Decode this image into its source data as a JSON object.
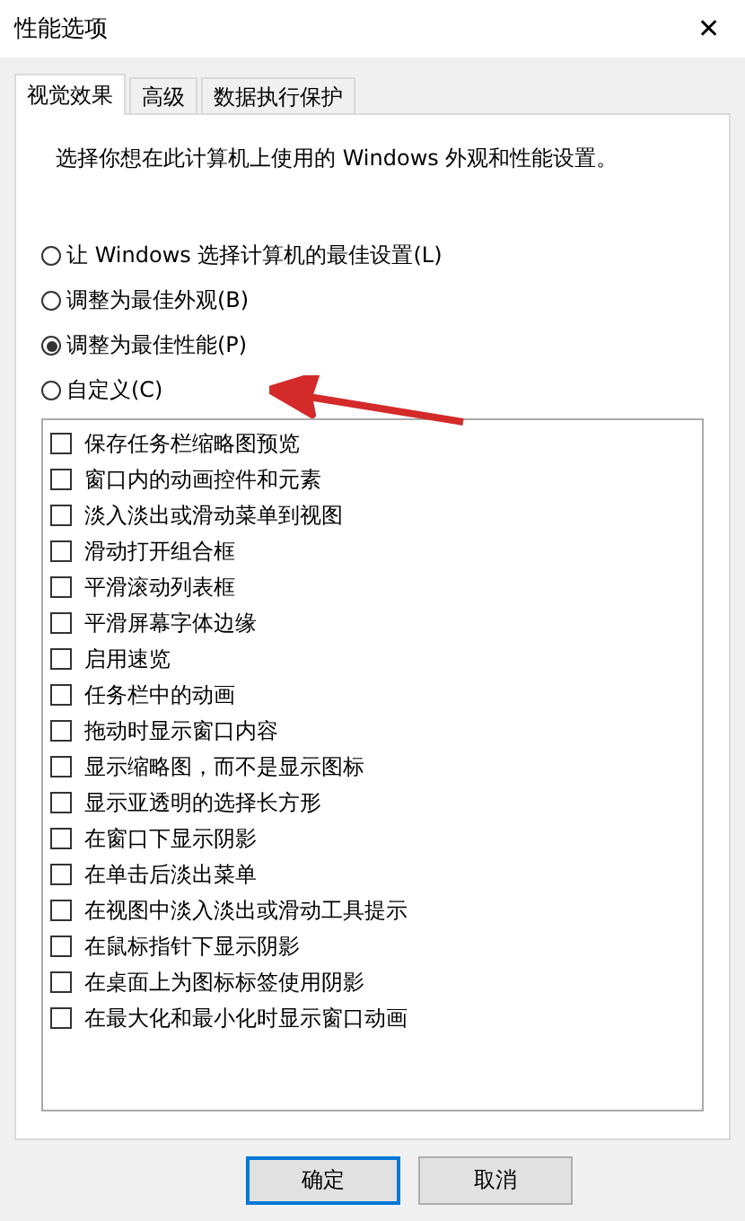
{
  "window": {
    "title": "性能选项",
    "close": "✕"
  },
  "tabs": [
    {
      "label": "视觉效果",
      "selected": true
    },
    {
      "label": "高级",
      "selected": false
    },
    {
      "label": "数据执行保护",
      "selected": false
    }
  ],
  "description": "选择你想在此计算机上使用的 Windows 外观和性能设置。",
  "options": [
    {
      "label": "让 Windows 选择计算机的最佳设置(L)",
      "selected": false
    },
    {
      "label": "调整为最佳外观(B)",
      "selected": false
    },
    {
      "label": "调整为最佳性能(P)",
      "selected": true
    },
    {
      "label": "自定义(C)",
      "selected": false
    }
  ],
  "effects": [
    {
      "label": "保存任务栏缩略图预览",
      "checked": false
    },
    {
      "label": "窗口内的动画控件和元素",
      "checked": false
    },
    {
      "label": "淡入淡出或滑动菜单到视图",
      "checked": false
    },
    {
      "label": "滑动打开组合框",
      "checked": false
    },
    {
      "label": "平滑滚动列表框",
      "checked": false
    },
    {
      "label": "平滑屏幕字体边缘",
      "checked": false
    },
    {
      "label": "启用速览",
      "checked": false
    },
    {
      "label": "任务栏中的动画",
      "checked": false
    },
    {
      "label": "拖动时显示窗口内容",
      "checked": false
    },
    {
      "label": "显示缩略图，而不是显示图标",
      "checked": false
    },
    {
      "label": "显示亚透明的选择长方形",
      "checked": false
    },
    {
      "label": "在窗口下显示阴影",
      "checked": false
    },
    {
      "label": "在单击后淡出菜单",
      "checked": false
    },
    {
      "label": "在视图中淡入淡出或滑动工具提示",
      "checked": false
    },
    {
      "label": "在鼠标指针下显示阴影",
      "checked": false
    },
    {
      "label": "在桌面上为图标标签使用阴影",
      "checked": false
    },
    {
      "label": "在最大化和最小化时显示窗口动画",
      "checked": false
    }
  ],
  "buttons": [
    {
      "label": "确定",
      "kind": "default"
    },
    {
      "label": "取消",
      "kind": "normal"
    }
  ],
  "annotation": {
    "kind": "arrow"
  }
}
